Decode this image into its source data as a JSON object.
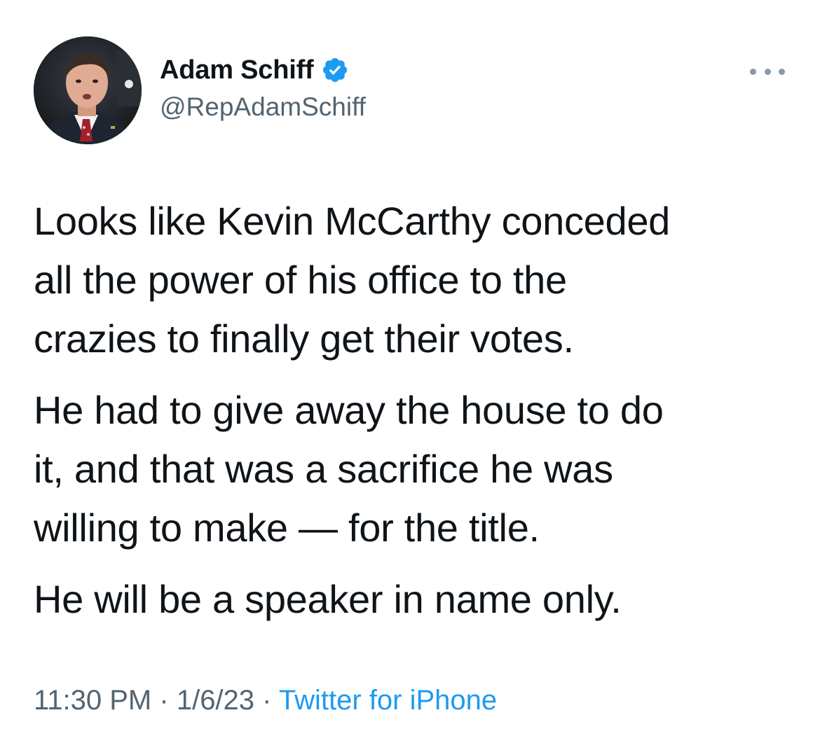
{
  "author": {
    "display_name": "Adam Schiff",
    "handle": "@RepAdamSchiff",
    "verified": true
  },
  "icons": {
    "verified": "verified-badge-icon",
    "more": "more-options-icon"
  },
  "tweet": {
    "paragraphs": [
      "Looks like Kevin McCarthy conceded\nall the power of his office to the\ncrazies to finally get their votes.",
      "He had to give away the house to do\nit, and that was a sacrifice he was\nwilling to make — for the title.",
      "He will be a speaker in name only."
    ]
  },
  "meta": {
    "time": "11:30 PM",
    "separator": "·",
    "date": "1/6/23",
    "source": "Twitter for iPhone"
  },
  "colors": {
    "text_primary": "#0f1419",
    "text_secondary": "#536471",
    "link": "#1d9bf0",
    "verified": "#1d9bf0"
  }
}
